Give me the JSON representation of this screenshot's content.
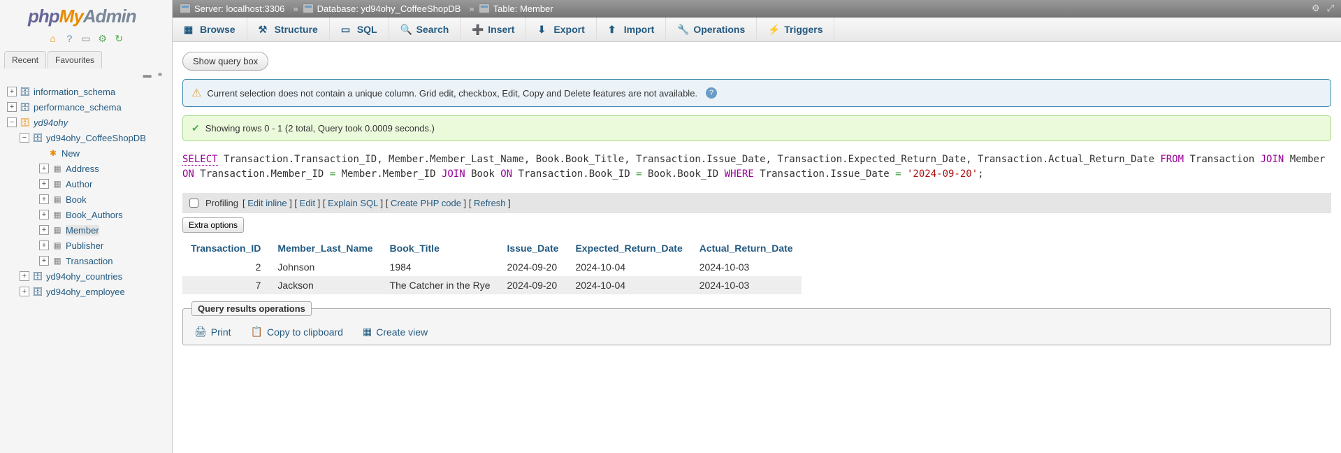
{
  "logo": {
    "php": "php",
    "my": "My",
    "admin": "Admin"
  },
  "sidebar": {
    "tabs": {
      "recent": "Recent",
      "favourites": "Favourites"
    },
    "tree": [
      {
        "label": "information_schema",
        "level": 0,
        "toggle": "+",
        "iconType": "db"
      },
      {
        "label": "performance_schema",
        "level": 0,
        "toggle": "+",
        "iconType": "db"
      },
      {
        "label": "yd94ohy",
        "level": 0,
        "toggle": "−",
        "iconType": "db-active",
        "active": true
      },
      {
        "label": "yd94ohy_CoffeeShopDB",
        "level": 1,
        "toggle": "−",
        "iconType": "db"
      },
      {
        "label": "New",
        "level": 2,
        "toggle": "",
        "iconType": "new"
      },
      {
        "label": "Address",
        "level": 3,
        "toggle": "+",
        "iconType": "table"
      },
      {
        "label": "Author",
        "level": 3,
        "toggle": "+",
        "iconType": "table"
      },
      {
        "label": "Book",
        "level": 3,
        "toggle": "+",
        "iconType": "table"
      },
      {
        "label": "Book_Authors",
        "level": 3,
        "toggle": "+",
        "iconType": "table"
      },
      {
        "label": "Member",
        "level": 3,
        "toggle": "+",
        "iconType": "table",
        "selected": true
      },
      {
        "label": "Publisher",
        "level": 3,
        "toggle": "+",
        "iconType": "table"
      },
      {
        "label": "Transaction",
        "level": 3,
        "toggle": "+",
        "iconType": "table"
      },
      {
        "label": "yd94ohy_countries",
        "level": 1,
        "toggle": "+",
        "iconType": "db"
      },
      {
        "label": "yd94ohy_employee",
        "level": 1,
        "toggle": "+",
        "iconType": "db"
      }
    ]
  },
  "breadcrumbs": {
    "server_label": "Server:",
    "server_value": "localhost:3306",
    "db_label": "Database:",
    "db_value": "yd94ohy_CoffeeShopDB",
    "table_label": "Table:",
    "table_value": "Member"
  },
  "toptabs": [
    {
      "label": "Browse",
      "icon": "browse"
    },
    {
      "label": "Structure",
      "icon": "structure"
    },
    {
      "label": "SQL",
      "icon": "sql"
    },
    {
      "label": "Search",
      "icon": "search"
    },
    {
      "label": "Insert",
      "icon": "insert"
    },
    {
      "label": "Export",
      "icon": "export"
    },
    {
      "label": "Import",
      "icon": "import"
    },
    {
      "label": "Operations",
      "icon": "operations"
    },
    {
      "label": "Triggers",
      "icon": "triggers"
    }
  ],
  "buttons": {
    "show_query": "Show query box",
    "extra_options": "Extra options"
  },
  "info_msg": "Current selection does not contain a unique column. Grid edit, checkbox, Edit, Copy and Delete features are not available.",
  "success_msg": "Showing rows 0 - 1 (2 total, Query took 0.0009 seconds.)",
  "sql_query": {
    "tokens": [
      {
        "t": "kw",
        "v": "SELECT"
      },
      {
        "t": "sp"
      },
      {
        "t": "id",
        "v": "Transaction"
      },
      {
        "t": "p",
        "v": "."
      },
      {
        "t": "id",
        "v": "Transaction_ID"
      },
      {
        "t": "p",
        "v": ", "
      },
      {
        "t": "id",
        "v": "Member"
      },
      {
        "t": "p",
        "v": "."
      },
      {
        "t": "id",
        "v": "Member_Last_Name"
      },
      {
        "t": "p",
        "v": ", "
      },
      {
        "t": "id",
        "v": "Book"
      },
      {
        "t": "p",
        "v": "."
      },
      {
        "t": "id",
        "v": "Book_Title"
      },
      {
        "t": "p",
        "v": ", "
      },
      {
        "t": "id",
        "v": "Transaction"
      },
      {
        "t": "p",
        "v": "."
      },
      {
        "t": "id",
        "v": "Issue_Date"
      },
      {
        "t": "p",
        "v": ", "
      },
      {
        "t": "id",
        "v": "Transaction"
      },
      {
        "t": "p",
        "v": "."
      },
      {
        "t": "id",
        "v": "Expected_Return_Date"
      },
      {
        "t": "p",
        "v": ", "
      },
      {
        "t": "id",
        "v": "Transaction"
      },
      {
        "t": "p",
        "v": "."
      },
      {
        "t": "id",
        "v": "Actual_Return_Date"
      },
      {
        "t": "sp"
      },
      {
        "t": "kwp",
        "v": "FROM"
      },
      {
        "t": "sp"
      },
      {
        "t": "id",
        "v": "Transaction"
      },
      {
        "t": "sp"
      },
      {
        "t": "kwp",
        "v": "JOIN"
      },
      {
        "t": "sp"
      },
      {
        "t": "id",
        "v": "Member"
      },
      {
        "t": "sp"
      },
      {
        "t": "kwp",
        "v": "ON"
      },
      {
        "t": "sp"
      },
      {
        "t": "id",
        "v": "Transaction"
      },
      {
        "t": "p",
        "v": "."
      },
      {
        "t": "id",
        "v": "Member_ID"
      },
      {
        "t": "sp"
      },
      {
        "t": "op",
        "v": "="
      },
      {
        "t": "sp"
      },
      {
        "t": "id",
        "v": "Member"
      },
      {
        "t": "p",
        "v": "."
      },
      {
        "t": "id",
        "v": "Member_ID"
      },
      {
        "t": "sp"
      },
      {
        "t": "kwp",
        "v": "JOIN"
      },
      {
        "t": "sp"
      },
      {
        "t": "id",
        "v": "Book"
      },
      {
        "t": "sp"
      },
      {
        "t": "kwp",
        "v": "ON"
      },
      {
        "t": "sp"
      },
      {
        "t": "id",
        "v": "Transaction"
      },
      {
        "t": "p",
        "v": "."
      },
      {
        "t": "id",
        "v": "Book_ID"
      },
      {
        "t": "sp"
      },
      {
        "t": "op",
        "v": "="
      },
      {
        "t": "sp"
      },
      {
        "t": "id",
        "v": "Book"
      },
      {
        "t": "p",
        "v": "."
      },
      {
        "t": "id",
        "v": "Book_ID"
      },
      {
        "t": "sp"
      },
      {
        "t": "kwp",
        "v": "WHERE"
      },
      {
        "t": "sp"
      },
      {
        "t": "id",
        "v": "Transaction"
      },
      {
        "t": "p",
        "v": "."
      },
      {
        "t": "id",
        "v": "Issue_Date"
      },
      {
        "t": "sp"
      },
      {
        "t": "op",
        "v": "="
      },
      {
        "t": "sp"
      },
      {
        "t": "str",
        "v": "'2024-09-20'"
      },
      {
        "t": "p",
        "v": ";"
      }
    ]
  },
  "query_toolbar": {
    "profiling": "Profiling",
    "links": [
      "Edit inline",
      "Edit",
      "Explain SQL",
      "Create PHP code",
      "Refresh"
    ]
  },
  "table": {
    "headers": [
      "Transaction_ID",
      "Member_Last_Name",
      "Book_Title",
      "Issue_Date",
      "Expected_Return_Date",
      "Actual_Return_Date"
    ],
    "rows": [
      [
        "2",
        "Johnson",
        "1984",
        "2024-09-20",
        "2024-10-04",
        "2024-10-03"
      ],
      [
        "7",
        "Jackson",
        "The Catcher in the Rye",
        "2024-09-20",
        "2024-10-04",
        "2024-10-03"
      ]
    ]
  },
  "results_ops": {
    "legend": "Query results operations",
    "print": "Print",
    "copy": "Copy to clipboard",
    "createview": "Create view"
  }
}
